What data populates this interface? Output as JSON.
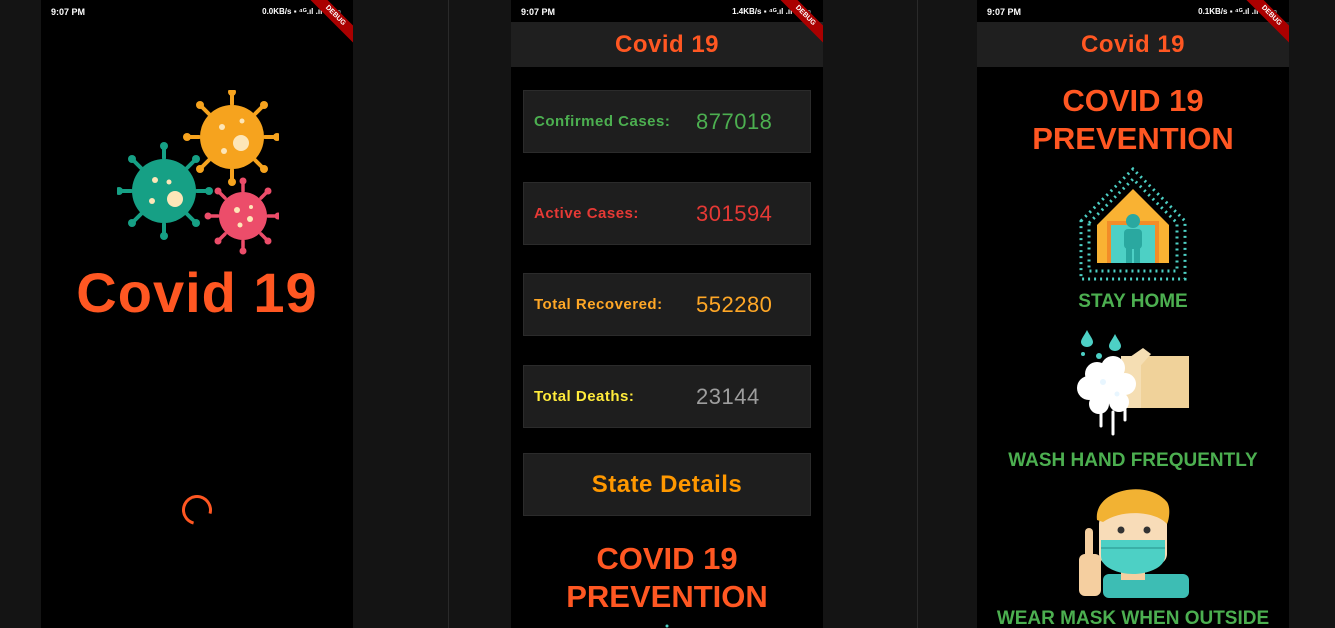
{
  "colors": {
    "accent": "#ff5722",
    "green": "#4caf50",
    "red": "#e53935",
    "orange": "#ffa726",
    "yellow": "#ffeb3b",
    "grey": "#9e9e9e"
  },
  "screens": [
    {
      "status": {
        "time": "9:07 PM",
        "net": "0.0KB/s"
      },
      "splash": {
        "title": "Covid 19"
      },
      "debug": "DEBUG"
    },
    {
      "status": {
        "time": "9:07 PM",
        "net": "1.4KB/s"
      },
      "appbar": {
        "title": "Covid 19"
      },
      "debug": "DEBUG",
      "stats": [
        {
          "label": "Confirmed Cases:",
          "value": "877018"
        },
        {
          "label": "Active Cases:",
          "value": "301594"
        },
        {
          "label": "Total Recovered:",
          "value": "552280"
        },
        {
          "label": "Total Deaths:",
          "value": "23144"
        }
      ],
      "state_button": "State Details",
      "prevention_title_1": "COVID 19",
      "prevention_title_2": "PREVENTION"
    },
    {
      "status": {
        "time": "9:07 PM",
        "net": "0.1KB/s"
      },
      "appbar": {
        "title": "Covid 19"
      },
      "debug": "DEBUG",
      "prevention_title_1": "COVID 19",
      "prevention_title_2": "PREVENTION",
      "items": [
        {
          "label": "STAY HOME",
          "icon": "stay-home-icon"
        },
        {
          "label": "WASH HAND FREQUENTLY",
          "icon": "hand-wash-icon"
        },
        {
          "label": "WEAR MASK WHEN OUTSIDE",
          "icon": "face-mask-icon"
        }
      ]
    }
  ]
}
